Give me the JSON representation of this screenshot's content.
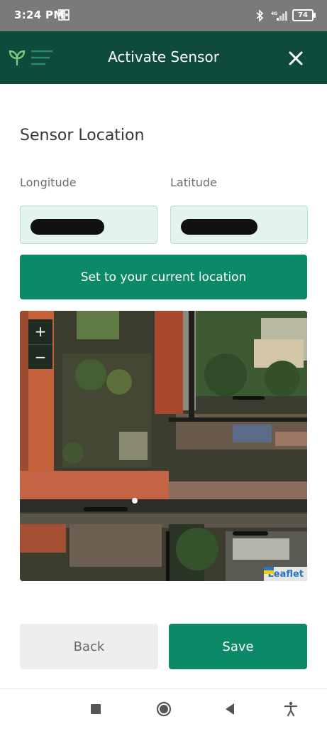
{
  "status_bar": {
    "time": "3:24 PM",
    "battery": "74",
    "icons": [
      "grid-icon",
      "bluetooth-icon",
      "signal-icon",
      "battery-icon"
    ]
  },
  "header": {
    "title": "Activate Sensor",
    "logo_icon": "sprout-menu-icon",
    "close_icon": "close-icon"
  },
  "form": {
    "section_title": "Sensor Location",
    "longitude_label": "Longitude",
    "latitude_label": "Latitude",
    "longitude_value": "",
    "latitude_value": "",
    "location_button_label": "Set to your current location"
  },
  "map": {
    "zoom_in_label": "+",
    "zoom_out_label": "−",
    "attribution": "Leaflet",
    "icons": [
      "ukraine-flag-icon"
    ]
  },
  "actions": {
    "back_label": "Back",
    "save_label": "Save"
  },
  "nav_bar": {
    "icons": [
      "recent-apps-icon",
      "home-icon",
      "back-icon",
      "accessibility-icon"
    ]
  },
  "colors": {
    "header_bg": "#0f4b3c",
    "accent": "#0c8a67",
    "input_bg": "#e3f3ee",
    "status_bar_bg": "#7a7a7a"
  }
}
